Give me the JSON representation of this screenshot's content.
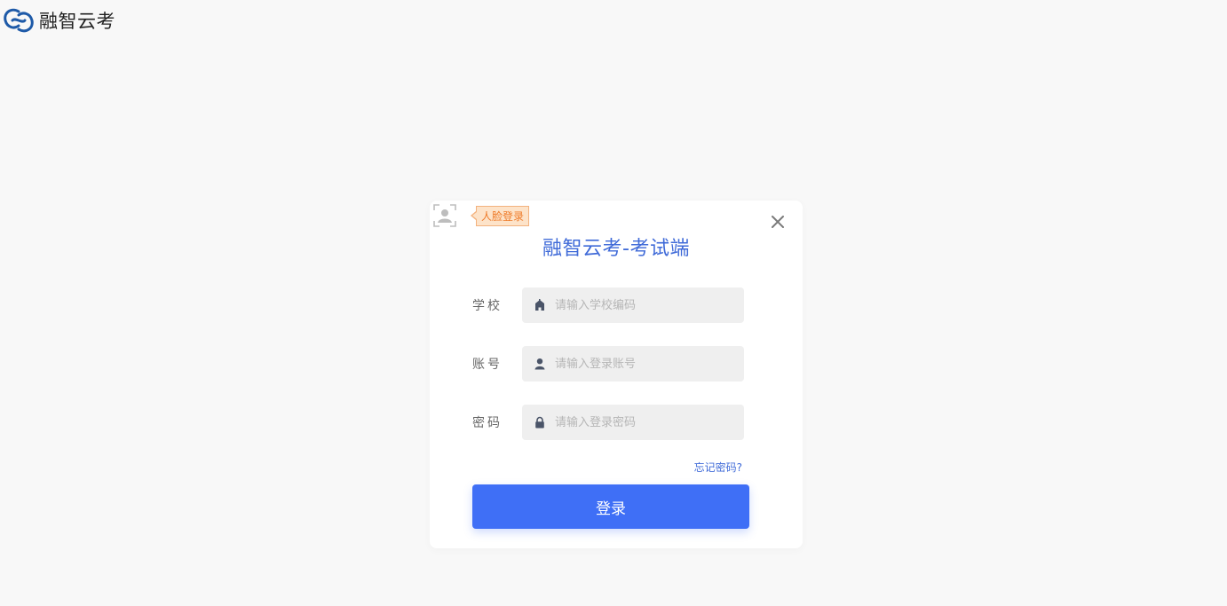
{
  "brand": {
    "name": "融智云考",
    "logo_icon": "cloud-swirl-icon",
    "logo_color": "#1e5aa8"
  },
  "login_card": {
    "face_login_icon": "face-scan-icon",
    "face_login_label": "人脸登录",
    "close_icon": "close-icon",
    "title": "融智云考-考试端",
    "fields": [
      {
        "label": "学校",
        "icon": "school-icon",
        "placeholder": "请输入学校编码",
        "value": ""
      },
      {
        "label": "账号",
        "icon": "user-icon",
        "placeholder": "请输入登录账号",
        "value": ""
      },
      {
        "label": "密码",
        "icon": "lock-icon",
        "placeholder": "请输入登录密码",
        "value": ""
      }
    ],
    "forgot_password": "忘记密码?",
    "submit_label": "登录"
  },
  "colors": {
    "page_background": "#f8f8f8",
    "title": "#3f6ad8",
    "primary_button": "#3f6ff6",
    "face_tag_background": "#fde3c9",
    "face_tag_text": "#ee7a28",
    "input_background": "#efefef"
  }
}
